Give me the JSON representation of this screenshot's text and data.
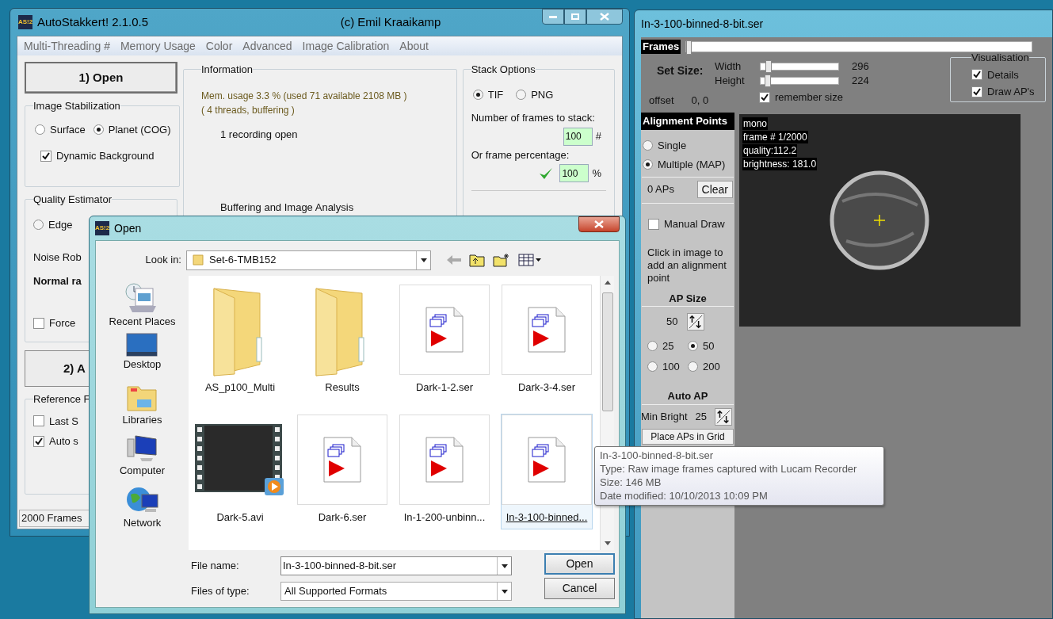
{
  "main_window": {
    "icon_text": "AS!2",
    "title": "AutoStakkert! 2.1.0.5",
    "subtitle": "(c) Emil Kraaikamp",
    "menu": [
      "Multi-Threading #",
      "Memory Usage",
      "Color",
      "Advanced",
      "Image Calibration",
      "About"
    ],
    "open_button": "1) Open",
    "image_stabilization": {
      "title": "Image Stabilization",
      "options": [
        {
          "label": "Surface",
          "selected": false
        },
        {
          "label": "Planet (COG)",
          "selected": true
        }
      ],
      "dynamic_background": {
        "label": "Dynamic Background",
        "checked": true
      }
    },
    "quality_estimator": {
      "title": "Quality Estimator",
      "options": [
        {
          "label": "Edge",
          "selected": false
        }
      ],
      "noise_label": "Noise Rob",
      "noise_value": "Normal ra",
      "force": {
        "label": "Force",
        "checked": false
      }
    },
    "analyse_button": "2) A",
    "reference_frame": {
      "title": "Reference F",
      "options": [
        {
          "label": "Last S",
          "checked": false
        },
        {
          "label": "Auto s",
          "checked": true
        }
      ]
    },
    "information": {
      "title": "Information",
      "memory": "Mem. usage 3.3 %  (used 71 available 2108 MB )",
      "threads": "( 4 threads, buffering )",
      "recordings": "1 recording open",
      "status": "Buffering and Image Analysis"
    },
    "stack_options": {
      "title": "Stack Options",
      "formats": [
        {
          "label": "TIF",
          "selected": true
        },
        {
          "label": "PNG",
          "selected": false
        }
      ],
      "frames_label": "Number of frames to stack:",
      "frames_value": "100",
      "frames_unit": "#",
      "percent_label": "Or frame percentage:",
      "percent_value": "100",
      "percent_unit": "%"
    },
    "status_bar": "2000 Frames"
  },
  "viewer": {
    "title": "In-3-100-binned-8-bit.ser",
    "frames_label": "Frames",
    "frames_slider": {
      "level": 0
    },
    "set_size_label": "Set Size:",
    "sliders": [
      {
        "label": "Width",
        "level": 0.07,
        "reading": "296"
      },
      {
        "label": "Height",
        "level": 0.05,
        "reading": "224"
      }
    ],
    "offset_label": "offset",
    "offset_value": "0, 0",
    "remember_size": {
      "label": "remember size",
      "checked": true
    },
    "visualisation": {
      "title": "Visualisation",
      "options": [
        {
          "label": "Details",
          "checked": true
        },
        {
          "label": "Draw AP's",
          "checked": true
        }
      ]
    },
    "alignment": {
      "title": "Alignment Points",
      "modes": [
        {
          "label": "Single",
          "selected": false
        },
        {
          "label": "Multiple (MAP)",
          "selected": true
        }
      ],
      "ap_count": "0 APs",
      "clear_button": "Clear",
      "manual_draw": {
        "label": "Manual Draw",
        "checked": false
      },
      "hint": "Click in image to add an alignment point",
      "ap_size_title": "AP Size",
      "ap_size_value": "50",
      "sizes": [
        {
          "label": "25",
          "selected": false
        },
        {
          "label": "50",
          "selected": true
        },
        {
          "label": "100",
          "selected": false
        },
        {
          "label": "200",
          "selected": false
        }
      ],
      "auto_ap_title": "Auto AP",
      "min_bright_label": "Min Bright",
      "min_bright_value": "25",
      "grid_button": "Place APs in Grid"
    },
    "overlay": [
      "mono",
      "frame # 1/2000",
      "quality:112.2",
      "brightness: 181.0"
    ]
  },
  "open_dialog": {
    "icon_text": "AS!2",
    "title": "Open",
    "look_in_label": "Look in:",
    "look_in_value": "Set-6-TMB152",
    "places": [
      {
        "label": "Recent Places",
        "kind": "recent"
      },
      {
        "label": "Desktop",
        "kind": "desktop"
      },
      {
        "label": "Libraries",
        "kind": "libraries"
      },
      {
        "label": "Computer",
        "kind": "computer"
      },
      {
        "label": "Network",
        "kind": "network"
      }
    ],
    "files": [
      {
        "name": "AS_p100_Multi",
        "kind": "folder",
        "selected": false
      },
      {
        "name": "Results",
        "kind": "folder",
        "selected": false
      },
      {
        "name": "Dark-1-2.ser",
        "kind": "ser",
        "selected": false
      },
      {
        "name": "Dark-3-4.ser",
        "kind": "ser",
        "selected": false
      },
      {
        "name": "Dark-5.avi",
        "kind": "video",
        "selected": false
      },
      {
        "name": "Dark-6.ser",
        "kind": "ser",
        "selected": false
      },
      {
        "name": "In-1-200-unbinn...",
        "kind": "ser",
        "selected": false
      },
      {
        "name": "In-3-100-binned...",
        "kind": "ser",
        "selected": true
      }
    ],
    "file_name_label": "File name:",
    "file_name_value": "In-3-100-binned-8-bit.ser",
    "file_type_label": "Files of type:",
    "file_type_value": "All Supported Formats",
    "buttons": [
      "Open",
      "Cancel"
    ]
  },
  "tooltip": [
    "In-3-100-binned-8-bit.ser",
    "Type: Raw image frames captured with Lucam Recorder",
    "Size: 146 MB",
    "Date modified: 10/10/2013 10:09 PM"
  ]
}
